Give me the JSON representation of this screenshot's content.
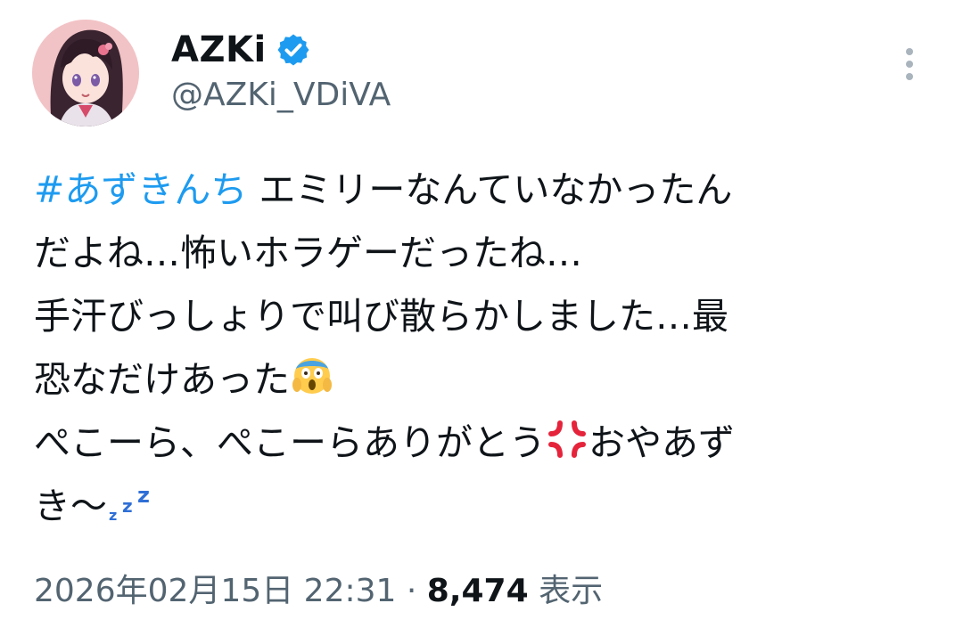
{
  "profile": {
    "display_name": "AZKi",
    "handle": "@AZKi_VDiVA",
    "verified_badge": "verified-badge-icon",
    "avatar": "avatar-image"
  },
  "colors": {
    "hashtag": "#1d9bf0",
    "verified": "#1d9bf0",
    "secondary_text": "#536471",
    "primary_text": "#0f1419"
  },
  "tweet": {
    "hashtag": "#あずきんち",
    "line1_rest": " エミリーなんていなかったん",
    "line2": "だよね…怖いホラゲーだったね…",
    "line3": "手汗びっしょりで叫び散らかしました…最",
    "line4_text": "恐なだけあった",
    "line4_emoji": "face-screaming-in-fear-emoji",
    "line5_text": "ぺこーら、ぺこーらありがとう",
    "line5_emoji": "anger-symbol-emoji",
    "line5_rest": "おやあず",
    "line6_text": "き〜",
    "line6_emoji": "zzz-emoji"
  },
  "meta": {
    "timestamp": "2026年02月15日 22:31",
    "separator": " · ",
    "views_count": "8,474",
    "views_label": " 表示"
  },
  "more_icon": "more-vertical-icon"
}
